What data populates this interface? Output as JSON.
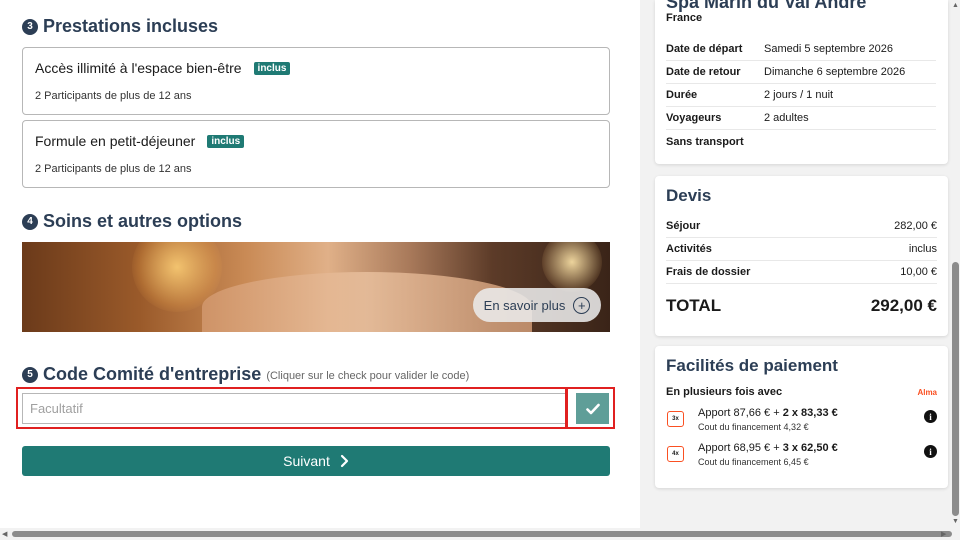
{
  "sections": {
    "prestations": {
      "number": "3",
      "title": "Prestations incluses",
      "items": [
        {
          "name": "Accès illimité à l'espace bien-être",
          "badge": "inclus",
          "participants": "2 Participants de plus de 12 ans"
        },
        {
          "name": "Formule en petit-déjeuner",
          "badge": "inclus",
          "participants": "2 Participants de plus de 12 ans"
        }
      ]
    },
    "options": {
      "number": "4",
      "title": "Soins et autres options",
      "learn_more": "En savoir plus"
    },
    "ce_code": {
      "number": "5",
      "title": "Code Comité d'entreprise",
      "hint": "(Cliquer sur le check pour valider le code)",
      "placeholder": "Facultatif",
      "value": ""
    }
  },
  "next_button": "Suivant",
  "summary": {
    "hotel": "Spa Marin du Val André",
    "country": "France",
    "rows": [
      {
        "label": "Date de départ",
        "value": "Samedi 5 septembre 2026"
      },
      {
        "label": "Date de retour",
        "value": "Dimanche 6 septembre 2026"
      },
      {
        "label": "Durée",
        "value": "2 jours / 1 nuit"
      },
      {
        "label": "Voyageurs",
        "value": "2 adultes"
      },
      {
        "label": "Sans transport",
        "value": ""
      }
    ]
  },
  "quote": {
    "title": "Devis",
    "rows": [
      {
        "label": "Séjour",
        "value": "282,00 €"
      },
      {
        "label": "Activités",
        "value": "inclus"
      },
      {
        "label": "Frais de dossier",
        "value": "10,00 €"
      }
    ],
    "total_label": "TOTAL",
    "total_value": "292,00 €"
  },
  "payment": {
    "title": "Facilités de paiement",
    "subtitle": "En plusieurs fois avec",
    "provider": "Alma",
    "options": [
      {
        "icon": "3x",
        "text_prefix": "Apport 87,66 € + ",
        "text_bold": "2 x 83,33 €",
        "cost": "Cout du financement 4,32 €"
      },
      {
        "icon": "4x",
        "text_prefix": "Apport 68,95 € + ",
        "text_bold": "3 x 62,50 €",
        "cost": "Cout du financement 6,45 €"
      }
    ]
  },
  "colors": {
    "primary": "#1f7a74",
    "heading": "#2c3e55",
    "highlight": "#e02020",
    "alma": "#fa5022"
  }
}
